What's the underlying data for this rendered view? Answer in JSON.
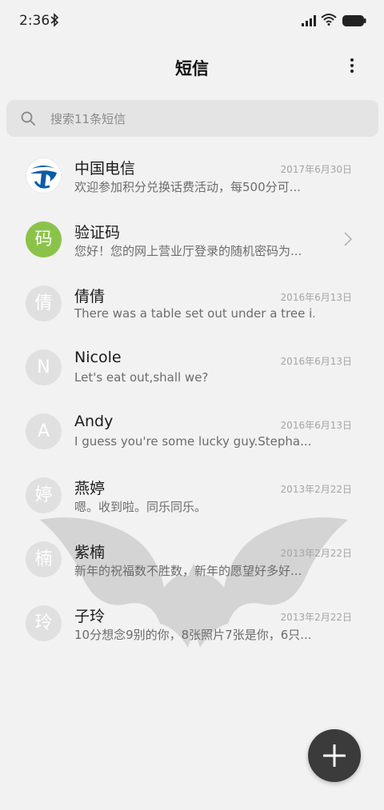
{
  "status_bar": {
    "time": "2:36",
    "icons": [
      "bluetooth-icon",
      "signal-icon",
      "wifi-icon",
      "battery-icon"
    ]
  },
  "header": {
    "title": "短信",
    "menu_icon": "more-vertical-icon"
  },
  "search": {
    "placeholder": "搜索11条短信",
    "icon": "search-icon"
  },
  "conversations": [
    {
      "name": "中国电信",
      "date": "2017年6月30日",
      "preview": "欢迎参加积分兑换话费活动，每500分可...",
      "avatar": "china-telecom-logo"
    },
    {
      "name": "验证码",
      "date": "",
      "preview": "您好！您的网上营业厅登录的随机密码为...",
      "avatar_text": "码",
      "avatar_color": "#8bc34a"
    },
    {
      "name": "倩倩",
      "date": "2016年6月13日",
      "preview": "There was a table set out under a tree i...",
      "avatar_text": "倩"
    },
    {
      "name": "Nicole",
      "date": "2016年6月13日",
      "preview": "Let's eat out,shall we?",
      "avatar_text": "N"
    },
    {
      "name": "Andy",
      "date": "2016年6月13日",
      "preview": "I guess you're some lucky guy.Stepha...",
      "avatar_text": "A"
    },
    {
      "name": "燕婷",
      "date": "2013年2月22日",
      "preview": "嗯。收到啦。同乐同乐。",
      "avatar_text": "婷"
    },
    {
      "name": "紫楠",
      "date": "2013年2月22日",
      "preview": "新年的祝福数不胜数，新年的愿望好多好...",
      "avatar_text": "楠"
    },
    {
      "name": "子玲",
      "date": "2013年2月22日",
      "preview": "10分想念9别的你，8张照片7张是你，6只...",
      "avatar_text": "玲"
    }
  ],
  "fab": {
    "icon": "plus-icon"
  },
  "colors": {
    "background": "#f2f2f2",
    "search_bg": "#e4e4e4",
    "avatar_default": "#e0e0e0",
    "avatar_verify": "#8bc34a",
    "telecom_blue": "#0b5ba8",
    "fab_bg": "#3b3b3b"
  }
}
